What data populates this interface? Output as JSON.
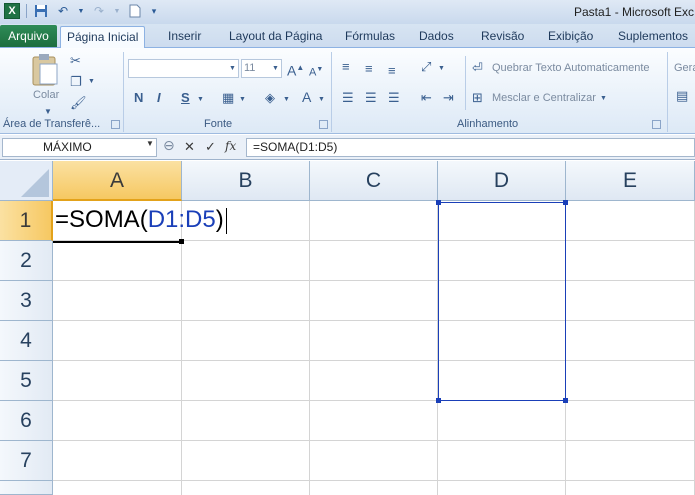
{
  "app": {
    "title": "Pasta1 - Microsoft Exc"
  },
  "tabs": {
    "file": "Arquivo",
    "items": [
      "Página Inicial",
      "Inserir",
      "Layout da Página",
      "Fórmulas",
      "Dados",
      "Revisão",
      "Exibição",
      "Suplementos"
    ],
    "active": "Página Inicial"
  },
  "ribbon": {
    "clipboard": {
      "label": "Área de Transferê...",
      "paste": "Colar"
    },
    "font": {
      "label": "Fonte",
      "size": "11",
      "bold": "N",
      "italic": "I",
      "underline": "S",
      "grow": "A",
      "shrink": "A",
      "color": "A"
    },
    "alignment": {
      "label": "Alinhamento",
      "wrap_text": "Quebrar Texto Automaticamente",
      "merge_center": "Mesclar e Centralizar"
    },
    "number": {
      "partial": "Gera"
    }
  },
  "formula_bar": {
    "name_box": "MÁXIMO",
    "fx": "fx",
    "formula": "=SOMA(D1:D5)"
  },
  "grid": {
    "columns": [
      "A",
      "B",
      "C",
      "D",
      "E"
    ],
    "rows": [
      "1",
      "2",
      "3",
      "4",
      "5",
      "6",
      "7"
    ],
    "active_cell": "A1",
    "edit": {
      "prefix": "=SOMA(",
      "ref": "D1:D5",
      "suffix": ")"
    },
    "reference_range": "D1:D5",
    "colors": {
      "reference": "#1a3fb8",
      "selected_header": "#f6c862"
    }
  }
}
